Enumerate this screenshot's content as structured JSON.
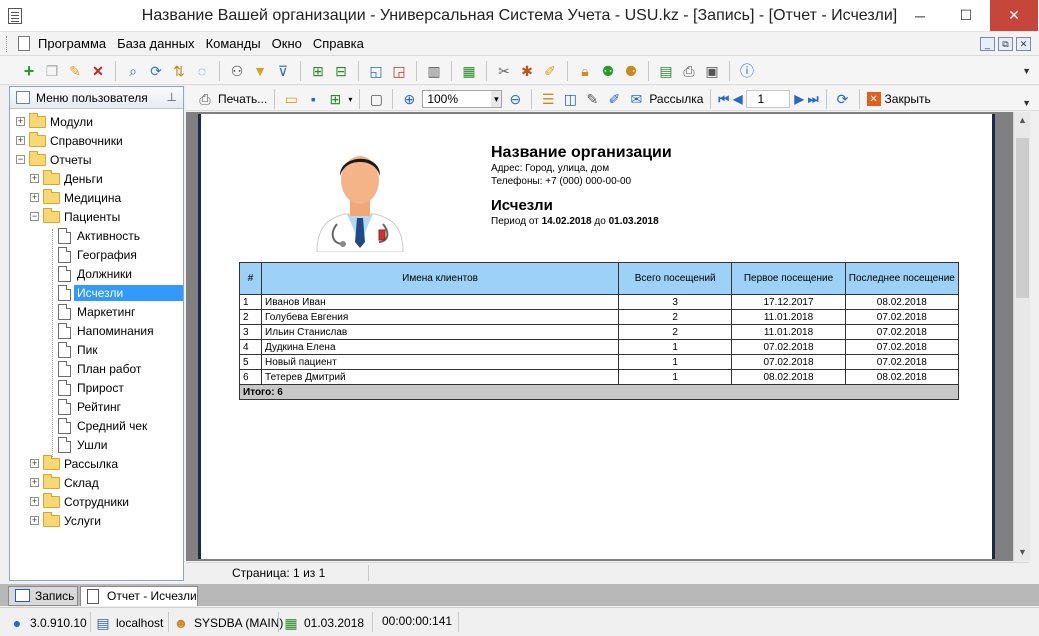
{
  "window": {
    "title": "Название Вашей организации - Универсальная Система Учета - USU.kz - [Запись] - [Отчет - Исчезли]",
    "minimize": "─",
    "maximize": "☐",
    "close": "✕"
  },
  "menu": {
    "items": [
      "Программа",
      "База данных",
      "Команды",
      "Окно",
      "Справка"
    ],
    "mdi_buttons": [
      "_",
      "⧉",
      "✕"
    ]
  },
  "sidebar": {
    "title": "Меню пользователя",
    "pin": "⊥",
    "tree": [
      {
        "label": "Модули",
        "type": "folder",
        "level": 0,
        "expanded": false
      },
      {
        "label": "Справочники",
        "type": "folder",
        "level": 0,
        "expanded": false
      },
      {
        "label": "Отчеты",
        "type": "folder",
        "level": 0,
        "expanded": true
      },
      {
        "label": "Деньги",
        "type": "folder",
        "level": 1,
        "expanded": false
      },
      {
        "label": "Медицина",
        "type": "folder",
        "level": 1,
        "expanded": false
      },
      {
        "label": "Пациенты",
        "type": "folder",
        "level": 1,
        "expanded": true
      },
      {
        "label": "Активность",
        "type": "doc",
        "level": 2
      },
      {
        "label": "География",
        "type": "doc",
        "level": 2
      },
      {
        "label": "Должники",
        "type": "doc",
        "level": 2
      },
      {
        "label": "Исчезли",
        "type": "doc",
        "level": 2,
        "selected": true
      },
      {
        "label": "Маркетинг",
        "type": "doc",
        "level": 2
      },
      {
        "label": "Напоминания",
        "type": "doc",
        "level": 2
      },
      {
        "label": "Пик",
        "type": "doc",
        "level": 2
      },
      {
        "label": "План работ",
        "type": "doc",
        "level": 2
      },
      {
        "label": "Прирост",
        "type": "doc",
        "level": 2
      },
      {
        "label": "Рейтинг",
        "type": "doc",
        "level": 2
      },
      {
        "label": "Средний чек",
        "type": "doc",
        "level": 2
      },
      {
        "label": "Ушли",
        "type": "doc",
        "level": 2
      },
      {
        "label": "Рассылка",
        "type": "folder",
        "level": 1,
        "expanded": false
      },
      {
        "label": "Склад",
        "type": "folder",
        "level": 1,
        "expanded": false
      },
      {
        "label": "Сотрудники",
        "type": "folder",
        "level": 1,
        "expanded": false
      },
      {
        "label": "Услуги",
        "type": "folder",
        "level": 1,
        "expanded": false
      }
    ]
  },
  "report_toolbar": {
    "print_label": "Печать...",
    "zoom": "100%",
    "mailing_label": "Рассылка",
    "page_value": "1",
    "close_label": "Закрыть"
  },
  "report": {
    "org_name": "Название организации",
    "address": "Адрес: Город, улица, дом",
    "phones": "Телефоны: +7 (000) 000-00-00",
    "title": "Исчезли",
    "period_prefix": "Период от",
    "period_from": "14.02.2018",
    "period_mid": "до",
    "period_to": "01.03.2018",
    "columns": [
      "#",
      "Имена клиентов",
      "Всего посещений",
      "Первое посещение",
      "Последнее посещение"
    ],
    "rows": [
      [
        "1",
        "Иванов Иван",
        "3",
        "17.12.2017",
        "08.02.2018"
      ],
      [
        "2",
        "Голубева Евгения",
        "2",
        "11.01.2018",
        "07.02.2018"
      ],
      [
        "3",
        "Ильин Станислав",
        "2",
        "11.01.2018",
        "07.02.2018"
      ],
      [
        "4",
        "Дудкина Елена",
        "1",
        "07.02.2018",
        "07.02.2018"
      ],
      [
        "5",
        "Новый пациент",
        "1",
        "07.02.2018",
        "07.02.2018"
      ],
      [
        "6",
        "Тетерев Дмитрий",
        "1",
        "08.02.2018",
        "08.02.2018"
      ]
    ],
    "total": "Итого: 6"
  },
  "page_status": "Страница: 1 из 1",
  "tabs": [
    {
      "label": "Запись",
      "active": false
    },
    {
      "label": "Отчет - Исчезли",
      "active": true
    }
  ],
  "statusbar": {
    "version": "3.0.910.10",
    "server": "localhost",
    "user": "SYSDBA (MAIN)",
    "date": "01.03.2018",
    "timer": "00:00:00:141"
  }
}
